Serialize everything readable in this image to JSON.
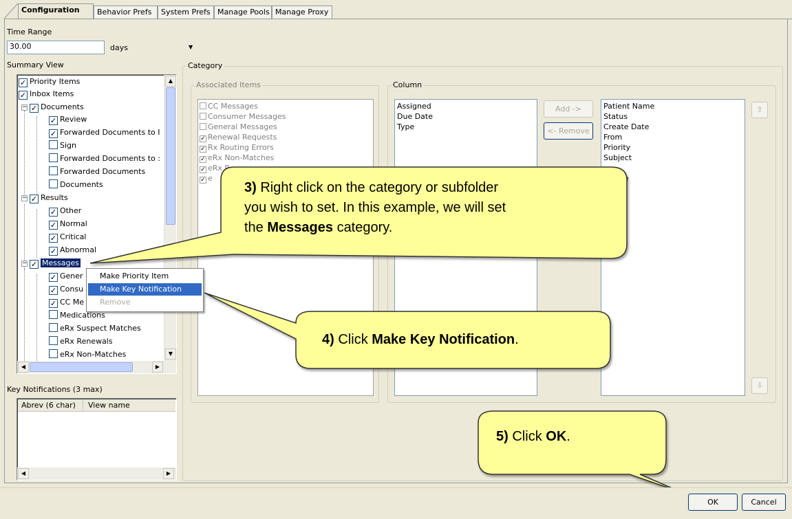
{
  "tabs": [
    "Configuration",
    "Behavior Prefs",
    "System Prefs",
    "Manage Pools",
    "Manage Proxy"
  ],
  "time_range": {
    "label": "Time Range",
    "value": "30.00",
    "unit": "days"
  },
  "summary_view": {
    "label": "Summary View",
    "items": [
      {
        "label": "Priority Items"
      },
      {
        "label": "Inbox Items"
      },
      {
        "label": "Documents"
      },
      {
        "label": "Review"
      },
      {
        "label": "Forwarded Documents to I"
      },
      {
        "label": "Sign"
      },
      {
        "label": "Forwarded Documents to :"
      },
      {
        "label": "Forwarded Documents"
      },
      {
        "label": "Documents"
      },
      {
        "label": "Results"
      },
      {
        "label": "Other"
      },
      {
        "label": "Normal"
      },
      {
        "label": "Critical"
      },
      {
        "label": "Abnormal"
      },
      {
        "label": "Messages"
      },
      {
        "label": "Gener"
      },
      {
        "label": "Consu"
      },
      {
        "label": "CC Me"
      },
      {
        "label": "Medications"
      },
      {
        "label": "eRx Suspect Matches"
      },
      {
        "label": "eRx Renewals"
      },
      {
        "label": "eRx Non-Matches"
      }
    ]
  },
  "key_notifications": {
    "label": "Key Notifications (3 max)",
    "col1": "Abrev (6 char)",
    "col2": "View name"
  },
  "category": {
    "label": "Category",
    "associated_label": "Associated Items",
    "associated_items": [
      "CC Messages",
      "Consumer Messages",
      "General Messages",
      "Renewal Requests",
      "Rx Routing Errors",
      "eRx Non-Matches",
      "eRx R",
      "e"
    ],
    "column_label": "Column",
    "column_left": [
      "Assigned",
      "Due Date",
      "Type"
    ],
    "add_button": "Add ->",
    "remove_button": "<- Remove",
    "column_right": [
      "Patient Name",
      "Status",
      "Create Date",
      "From",
      "Priority",
      "Subject",
      "",
      "e Date"
    ]
  },
  "context_menu": [
    "Make Priority Item",
    "Make Key Notification",
    "Remove"
  ],
  "callouts": {
    "c3_num": "3)",
    "c3_l1": "Right click on the category or subfolder",
    "c3_l2": "you wish to set.  In this example, we will set",
    "c3_l3a": "the",
    "c3_l3b": "Messages",
    "c3_l3c": "category.",
    "c4_num": "4)",
    "c4_a": "Click",
    "c4_b": "Make Key Notification",
    "c4_c": ".",
    "c5_num": "5)",
    "c5_a": "Click",
    "c5_b": "OK",
    "c5_c": "."
  },
  "buttons": {
    "ok": "OK",
    "cancel": "Cancel"
  },
  "colors": {
    "selection": "#0a246a",
    "menu_highlight": "#316ac5",
    "callout_fill": "#ffff99",
    "callout_border": "#333333"
  }
}
